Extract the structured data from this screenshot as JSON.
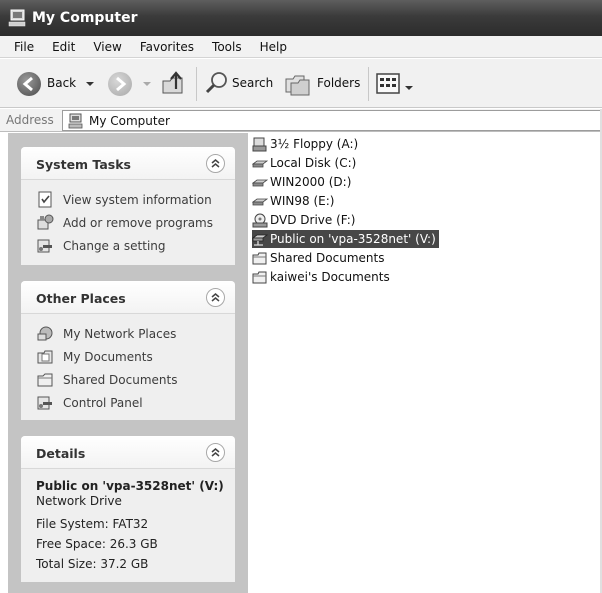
{
  "window": {
    "title": "My Computer",
    "title_icon": "computer-icon"
  },
  "menu": [
    "File",
    "Edit",
    "View",
    "Favorites",
    "Tools",
    "Help"
  ],
  "toolbar": {
    "back_label": "Back",
    "search_label": "Search",
    "folders_label": "Folders"
  },
  "address": {
    "label": "Address",
    "value": "My Computer"
  },
  "system_tasks": {
    "title": "System Tasks",
    "items": [
      {
        "label": "View system information",
        "icon": "system-info-icon"
      },
      {
        "label": "Add or remove programs",
        "icon": "add-remove-programs-icon"
      },
      {
        "label": "Change a setting",
        "icon": "control-panel-icon"
      }
    ]
  },
  "other_places": {
    "title": "Other Places",
    "items": [
      {
        "label": "My Network Places",
        "icon": "network-places-icon"
      },
      {
        "label": "My Documents",
        "icon": "my-documents-icon"
      },
      {
        "label": "Shared Documents",
        "icon": "folder-icon"
      },
      {
        "label": "Control Panel",
        "icon": "control-panel-icon"
      }
    ]
  },
  "details": {
    "title": "Details",
    "name": "Public on 'vpa-3528net' (V:)",
    "type": "Network Drive",
    "file_system": "File System: FAT32",
    "free_space": "Free Space: 26.3 GB",
    "total_size": "Total Size: 37.2 GB"
  },
  "drives": [
    {
      "label": "3½ Floppy (A:)",
      "icon": "floppy-drive-icon",
      "selected": false
    },
    {
      "label": "Local Disk (C:)",
      "icon": "hard-disk-icon",
      "selected": false
    },
    {
      "label": "WIN2000 (D:)",
      "icon": "hard-disk-icon",
      "selected": false
    },
    {
      "label": "WIN98 (E:)",
      "icon": "hard-disk-icon",
      "selected": false
    },
    {
      "label": "DVD Drive (F:)",
      "icon": "dvd-drive-icon",
      "selected": false
    },
    {
      "label": "Public on 'vpa-3528net' (V:)",
      "icon": "network-drive-icon",
      "selected": true
    },
    {
      "label": "Shared Documents",
      "icon": "folder-icon",
      "selected": false
    },
    {
      "label": "kaiwei's Documents",
      "icon": "folder-icon",
      "selected": false
    }
  ]
}
